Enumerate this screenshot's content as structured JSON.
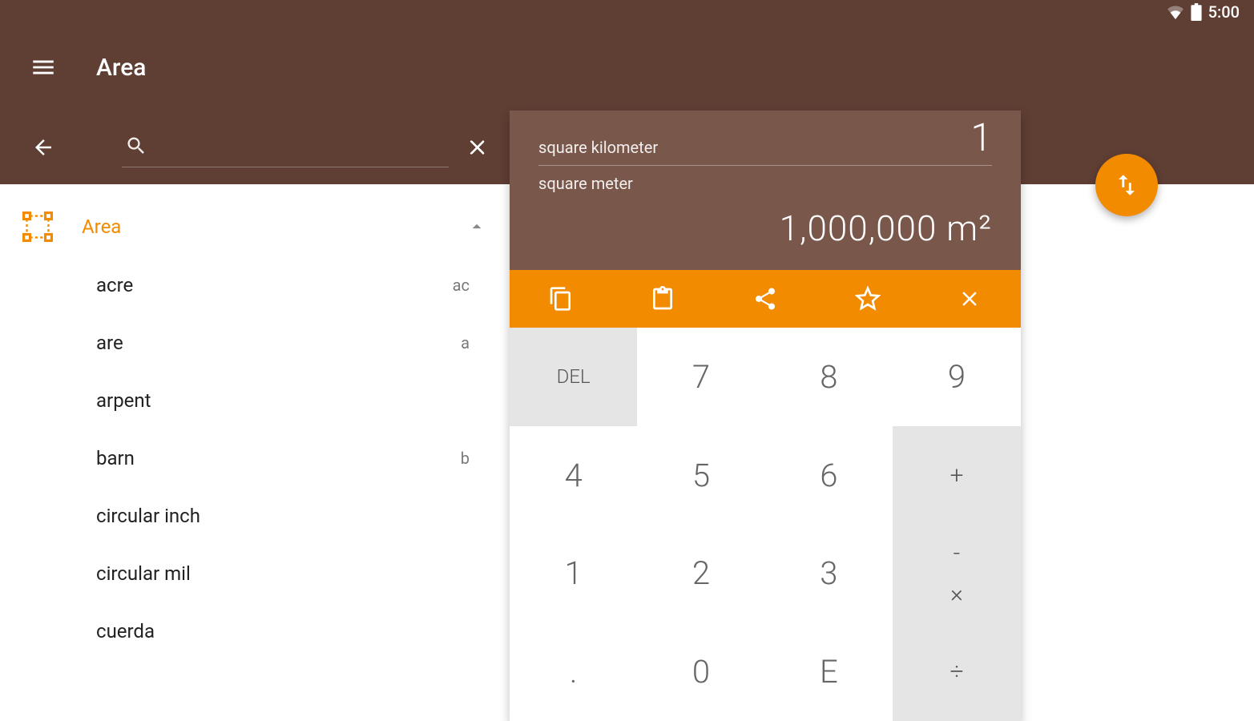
{
  "status": {
    "time": "5:00"
  },
  "header": {
    "title": "Area"
  },
  "category": {
    "label": "Area"
  },
  "units": [
    {
      "name": "acre",
      "abbr": "ac"
    },
    {
      "name": "are",
      "abbr": "a"
    },
    {
      "name": "arpent",
      "abbr": ""
    },
    {
      "name": "barn",
      "abbr": "b"
    },
    {
      "name": "circular inch",
      "abbr": ""
    },
    {
      "name": "circular mil",
      "abbr": ""
    },
    {
      "name": "cuerda",
      "abbr": ""
    }
  ],
  "calc": {
    "src_label": "square kilometer",
    "src_value": "1",
    "tgt_label": "square meter",
    "tgt_value": "1,000,000 m²"
  },
  "keys": {
    "k7": "7",
    "k8": "8",
    "k9": "9",
    "del": "DEL",
    "k4": "4",
    "k5": "5",
    "k6": "6",
    "plus": "+",
    "k1": "1",
    "k2": "2",
    "k3": "3",
    "minus": "-",
    "dot": ".",
    "k0": "0",
    "kE": "E",
    "mult": "×",
    "div": "÷"
  }
}
